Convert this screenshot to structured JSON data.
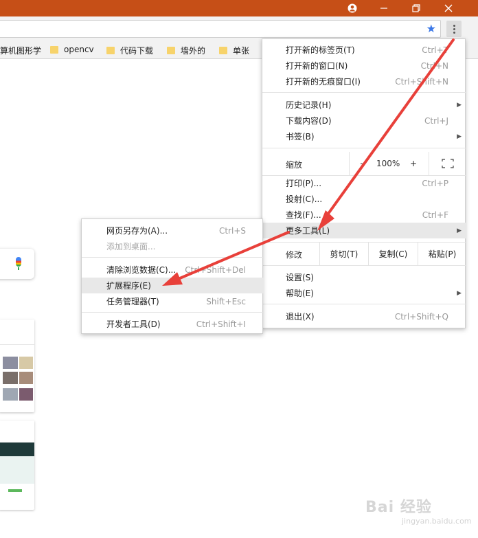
{
  "colors": {
    "titlebar": "#c64f17",
    "star": "#3b78e7",
    "arrow": "#e8403a"
  },
  "bookmarks": [
    {
      "label": "算机图形学",
      "icon": "folder-icon"
    },
    {
      "label": "opencv",
      "icon": "folder-icon"
    },
    {
      "label": "代码下载",
      "icon": "folder-icon"
    },
    {
      "label": "墙外的",
      "icon": "folder-icon"
    },
    {
      "label": "单张",
      "icon": "folder-icon"
    }
  ],
  "menu": {
    "new_tab": {
      "label": "打开新的标签页(T)",
      "shortcut": "Ctrl+T"
    },
    "new_window": {
      "label": "打开新的窗口(N)",
      "shortcut": "Ctrl+N"
    },
    "incognito": {
      "label": "打开新的无痕窗口(I)",
      "shortcut": "Ctrl+Shift+N"
    },
    "history": {
      "label": "历史记录(H)"
    },
    "downloads": {
      "label": "下载内容(D)",
      "shortcut": "Ctrl+J"
    },
    "bookmarks": {
      "label": "书签(B)"
    },
    "zoom": {
      "label": "缩放",
      "minus": "-",
      "value": "100%",
      "plus": "+"
    },
    "print": {
      "label": "打印(P)...",
      "shortcut": "Ctrl+P"
    },
    "cast": {
      "label": "投射(C)..."
    },
    "find": {
      "label": "查找(F)...",
      "shortcut": "Ctrl+F"
    },
    "more_tools": {
      "label": "更多工具(L)"
    },
    "edit": {
      "label": "修改",
      "cut": "剪切(T)",
      "copy": "复制(C)",
      "paste": "粘贴(P)"
    },
    "settings": {
      "label": "设置(S)"
    },
    "help": {
      "label": "帮助(E)"
    },
    "exit": {
      "label": "退出(X)",
      "shortcut": "Ctrl+Shift+Q"
    }
  },
  "submenu": {
    "save_page": {
      "label": "网页另存为(A)...",
      "shortcut": "Ctrl+S"
    },
    "add_desktop": {
      "label": "添加到桌面..."
    },
    "clear_data": {
      "label": "清除浏览数据(C)...",
      "shortcut": "Ctrl+Shift+Del"
    },
    "extensions": {
      "label": "扩展程序(E)"
    },
    "task_manager": {
      "label": "任务管理器(T)",
      "shortcut": "Shift+Esc"
    },
    "dev_tools": {
      "label": "开发者工具(D)",
      "shortcut": "Ctrl+Shift+I"
    }
  },
  "watermark": {
    "brand": "Bai 经验",
    "sub": "jingyan.baidu.com"
  }
}
